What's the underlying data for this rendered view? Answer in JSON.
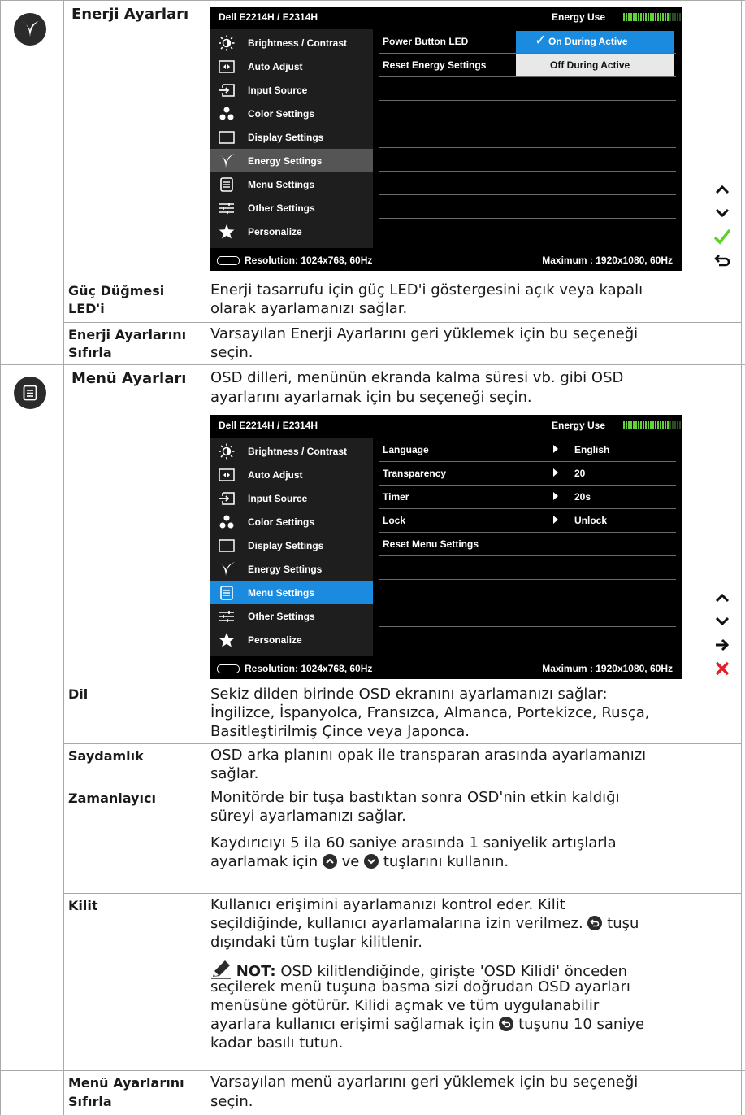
{
  "section_energy": {
    "label": "Enerji Ayarları",
    "icon": "energy-leaf-icon",
    "osd": {
      "model": "Dell E2214H / E2314H",
      "energy_use": "Energy Use",
      "menu": [
        "Brightness / Contrast",
        "Auto Adjust",
        "Input Source",
        "Color Settings",
        "Display Settings",
        "Energy Settings",
        "Menu Settings",
        "Other Settings",
        "Personalize"
      ],
      "rows": [
        {
          "name": "Power Button LED",
          "value": "On During Active"
        },
        {
          "name": "Reset Energy Settings",
          "value": "Off During Active"
        }
      ],
      "resolution": "Resolution: 1024x768,  60Hz",
      "maximum": "Maximum : 1920x1080,  60Hz",
      "check": "✓"
    },
    "buttons": [
      "up-arrow",
      "down-arrow",
      "check",
      "back"
    ]
  },
  "row_power_led": {
    "label_1": "Güç Düğmesi",
    "label_2": "LED'i",
    "desc_1": "Enerji tasarrufu için güç LED'i göstergesini açık veya kapalı",
    "desc_2": "olarak ayarlamanızı sağlar."
  },
  "row_reset_energy": {
    "label_1": "Enerji Ayarlarını",
    "label_2": "Sıfırla",
    "desc_1": "Varsayılan Enerji Ayarlarını geri yüklemek için bu seçeneği",
    "desc_2": "seçin."
  },
  "section_menu": {
    "label": "Menü Ayarları",
    "desc_1": "OSD dilleri, menünün ekranda kalma süresi vb. gibi OSD",
    "desc_2": "ayarlarını ayarlamak için bu seçeneği seçin.",
    "osd": {
      "model": "Dell E2214H / E2314H",
      "energy_use": "Energy Use",
      "rows": [
        {
          "name": "Language",
          "value": "English"
        },
        {
          "name": "Transparency",
          "value": "20"
        },
        {
          "name": "Timer",
          "value": "20s"
        },
        {
          "name": "Lock",
          "value": "Unlock"
        },
        {
          "name": "Reset Menu Settings",
          "value": ""
        }
      ],
      "resolution": "Resolution: 1024x768,  60Hz",
      "maximum": "Maximum : 1920x1080,  60Hz"
    }
  },
  "row_language": {
    "label": "Dil",
    "desc_1": "Sekiz dilden birinde OSD ekranını ayarlamanızı sağlar:",
    "desc_2": "İngilizce, İspanyolca, Fransızca, Almanca, Portekizce, Rusça,",
    "desc_3": "Basitleştirilmiş Çince veya Japonca."
  },
  "row_transparency": {
    "label": "Saydamlık",
    "desc_1": "OSD arka planını opak ile transparan arasında ayarlamanızı",
    "desc_2": "sağlar."
  },
  "row_timer": {
    "label": "Zamanlayıcı",
    "desc_1": "Monitörde bir tuşa bastıktan sonra OSD'nin etkin kaldığı",
    "desc_2": "süreyi ayarlamanızı sağlar.",
    "desc_3": "Kaydırıcıyı 5 ila 60 saniye arasında 1 saniyelik artışlarla",
    "desc_4a": "ayarlamak için",
    "desc_4b": "ve",
    "desc_4c": "tuşlarını kullanın."
  },
  "row_lock": {
    "label": "Kilit",
    "desc_1": "Kullanıcı erişimini ayarlamanızı kontrol eder. Kilit",
    "desc_2a": "seçildiğinde, kullanıcı ayarlamalarına izin verilmez.",
    "desc_2b": "tuşu",
    "desc_3": "dışındaki tüm tuşlar kilitlenir.",
    "note_label": "NOT:",
    "note_1": "OSD kilitlendiğinde, girişte 'OSD Kilidi' önceden",
    "note_2": "seçilerek menü tuşuna basma sizi doğrudan OSD ayarları",
    "note_3": "menüsüne götürür. Kilidi açmak ve tüm uygulanabilir",
    "note_4a": "ayarlara kullanıcı erişimi sağlamak için",
    "note_4b": "tuşunu 10 saniye",
    "note_5": "kadar basılı tutun."
  },
  "row_reset_menu": {
    "label_1": "Menü Ayarlarını",
    "label_2": "Sıfırla",
    "desc_1": "Varsayılan menü ayarlarını geri yüklemek için bu seçeneği",
    "desc_2": "seçin."
  },
  "colors": {
    "accent_blue": "#1b8be0",
    "energy_green": "#63d13a",
    "check_green": "#5bd12a",
    "close_red": "#e0202a"
  }
}
